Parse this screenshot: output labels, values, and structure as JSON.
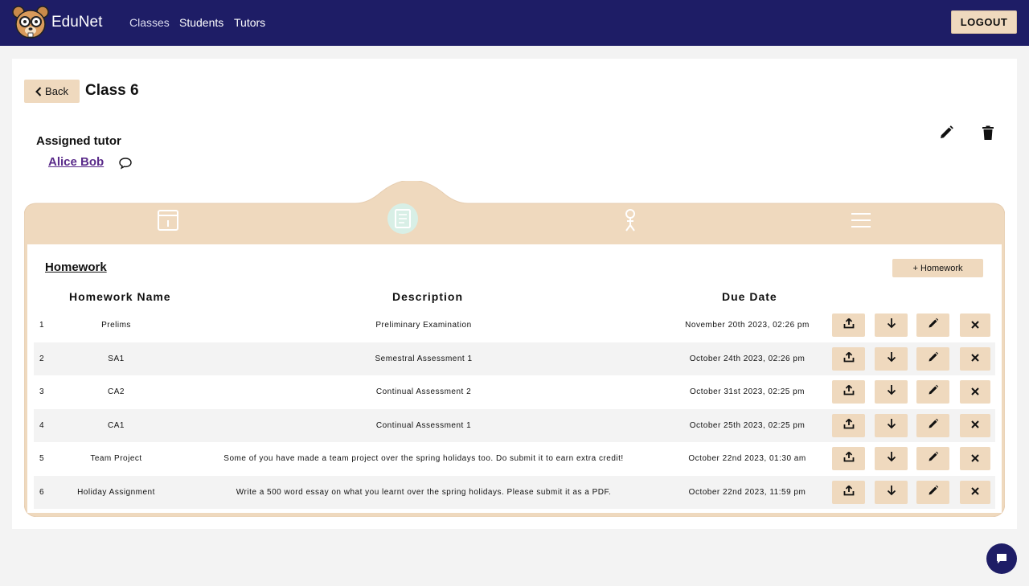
{
  "app": {
    "brand": "EduNet"
  },
  "nav": {
    "classes": "Classes",
    "students": "Students",
    "tutors": "Tutors",
    "logout": "LOGOUT"
  },
  "page": {
    "back_label": "Back",
    "title": "Class 6"
  },
  "tutor": {
    "heading": "Assigned tutor",
    "name": "Alice Bob"
  },
  "tabs": [
    "subjects-icon",
    "homework-icon",
    "person-icon",
    "list-icon"
  ],
  "homework": {
    "title": "Homework",
    "add_label": "+ Homework",
    "headers": {
      "name": "Homework Name",
      "description": "Description",
      "due": "Due Date"
    },
    "rows": [
      {
        "idx": "1",
        "name": "Prelims",
        "description": "Preliminary Examination",
        "due": "November 20th 2023, 02:26 pm"
      },
      {
        "idx": "2",
        "name": "SA1",
        "description": "Semestral Assessment 1",
        "due": "October 24th 2023, 02:26 pm"
      },
      {
        "idx": "3",
        "name": "CA2",
        "description": "Continual Assessment 2",
        "due": "October 31st 2023, 02:25 pm"
      },
      {
        "idx": "4",
        "name": "CA1",
        "description": "Continual Assessment 1",
        "due": "October 25th 2023, 02:25 pm"
      },
      {
        "idx": "5",
        "name": "Team Project",
        "description": "Some of you have made a team project over the spring holidays too. Do submit it to earn extra credit!",
        "due": "October 22nd 2023, 01:30 am"
      },
      {
        "idx": "6",
        "name": "Holiday Assignment",
        "description": "Write a 500 word essay on what you learnt over the spring holidays. Please submit it as a PDF.",
        "due": "October 22nd 2023, 11:59 pm"
      }
    ]
  },
  "colors": {
    "navbar": "#1e1d66",
    "accent": "#efd9be",
    "link": "#5a2b8a",
    "active_tab": "#d8efe6"
  }
}
